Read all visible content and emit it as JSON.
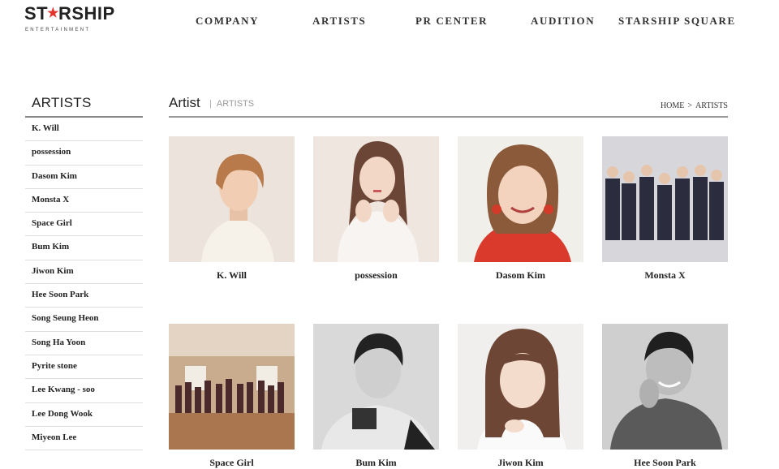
{
  "header": {
    "logo_text": "STARSHIP",
    "logo_sub": "ENTERTAINMENT",
    "nav": [
      "COMPANY",
      "ARTISTS",
      "PR CENTER",
      "AUDITION",
      "STARSHIP SQUARE"
    ]
  },
  "sidebar": {
    "title": "ARTISTS",
    "items": [
      "K. Will",
      "possession",
      "Dasom Kim",
      "Monsta X",
      "Space Girl",
      "Bum Kim",
      "Jiwon Kim",
      "Hee Soon Park",
      "Song Seung Heon",
      "Song Ha Yoon",
      "Pyrite stone",
      "Lee Kwang - soo",
      "Lee Dong Wook",
      "Miyeon Lee"
    ]
  },
  "content": {
    "title": "Artist",
    "subtitle": "ARTISTS",
    "breadcrumb": [
      "HOME",
      "ARTISTS"
    ]
  },
  "artists": [
    {
      "name": "K. Will",
      "bg": "#ece4dc"
    },
    {
      "name": "possession",
      "bg": "#efe6e0"
    },
    {
      "name": "Dasom Kim",
      "bg": "#f1efe9"
    },
    {
      "name": "Monsta X",
      "bg": "#d7d6db"
    },
    {
      "name": "Space Girl",
      "bg": "#c9ac8e"
    },
    {
      "name": "Bum Kim",
      "bg": "#d9d9d9"
    },
    {
      "name": "Jiwon Kim",
      "bg": "#f1efed"
    },
    {
      "name": "Hee Soon Park",
      "bg": "#cfcfcf"
    }
  ]
}
